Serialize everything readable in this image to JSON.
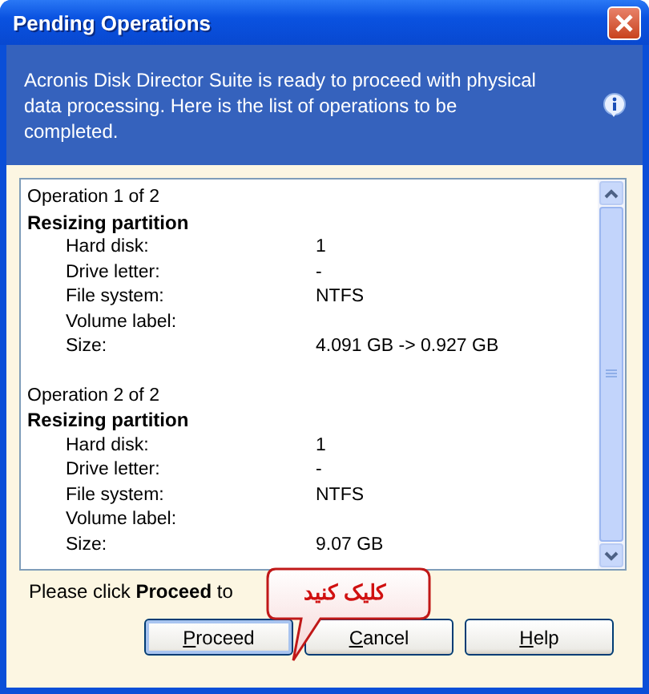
{
  "window": {
    "title": "Pending Operations"
  },
  "header": {
    "message": "Acronis Disk Director Suite is ready to proceed with physical data processing. Here is the list of operations to be completed."
  },
  "operations": [
    {
      "heading": "Operation 1 of 2",
      "title": "Resizing partition",
      "fields": [
        {
          "label": "Hard disk:",
          "value": "1"
        },
        {
          "label": "Drive letter:",
          "value": "-"
        },
        {
          "label": "File system:",
          "value": "NTFS"
        },
        {
          "label": "Volume label:"
        },
        {
          "label": "Size:",
          "value": "4.091 GB -> 0.927 GB"
        }
      ]
    },
    {
      "heading": "Operation 2 of 2",
      "title": "Resizing partition",
      "fields": [
        {
          "label": "Hard disk:",
          "value": "1"
        },
        {
          "label": "Drive letter:",
          "value": "-"
        },
        {
          "label": "File system:",
          "value": "NTFS"
        },
        {
          "label": "Volume label:"
        },
        {
          "label": "Size:",
          "value": "9.07 GB"
        }
      ]
    }
  ],
  "instruction": "Please click **Proceed** to",
  "buttons": [
    {
      "label": "Proceed",
      "default": true
    },
    {
      "label": "Cancel",
      "default": false
    },
    {
      "label": "Help",
      "default": false
    }
  ],
  "callout": {
    "text": "کلیک کنید"
  }
}
